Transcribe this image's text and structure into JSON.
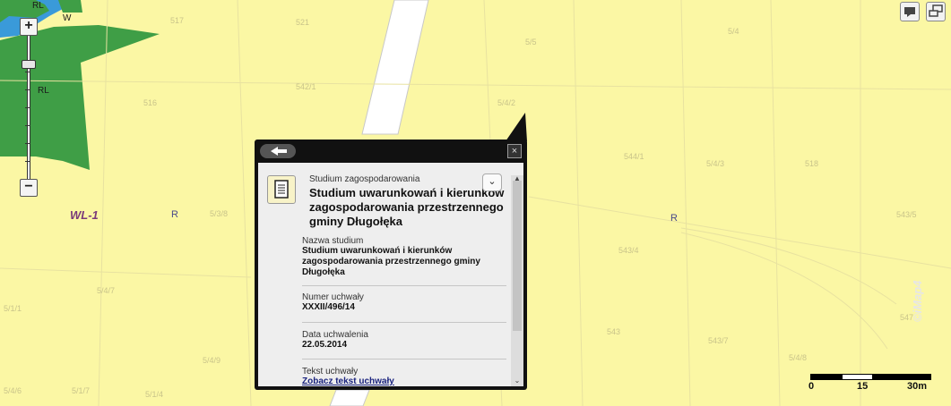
{
  "map": {
    "zone_labels": [
      "RL",
      "W",
      "RL",
      "WL-1",
      "R",
      "R"
    ],
    "parcel_labels": [
      "517",
      "516",
      "521",
      "5/5",
      "5/4",
      "542/1",
      "5/4/2",
      "544/1",
      "5/4/3",
      "518",
      "5/3/8",
      "543/4",
      "543/5",
      "5/4/7",
      "547",
      "543",
      "543/7",
      "5/1/1",
      "5/1/7",
      "5/1/4",
      "5/4/6",
      "5/4/9",
      "5/4/8"
    ],
    "colors": {
      "background": "#fbf7a4",
      "green": "#3f9e46",
      "water": "#3a9ad9",
      "road": "#ffffff"
    }
  },
  "zoom": {
    "in_label": "+",
    "out_label": "−"
  },
  "scale": {
    "ticks": [
      "0",
      "15",
      "30m"
    ]
  },
  "popup": {
    "type_label": "Studium zagospodarowania",
    "title": "Studium uwarunkowań i kierunków zagospodarowania przestrzennego gminy Długołęka",
    "fields": [
      {
        "label": "Nazwa studium",
        "value": "Studium uwarunkowań i kierunków zagospodarowania przestrzennego gminy Długołęka"
      },
      {
        "label": "Numer uchwały",
        "value": "XXXII/496/14"
      },
      {
        "label": "Data uchwalenia",
        "value": "22.05.2014"
      },
      {
        "label": "Tekst uchwały",
        "link": "Zobacz tekst uchwały"
      }
    ],
    "close_label": "×",
    "expand_label": "⌄"
  },
  "watermark": "©iMap4"
}
